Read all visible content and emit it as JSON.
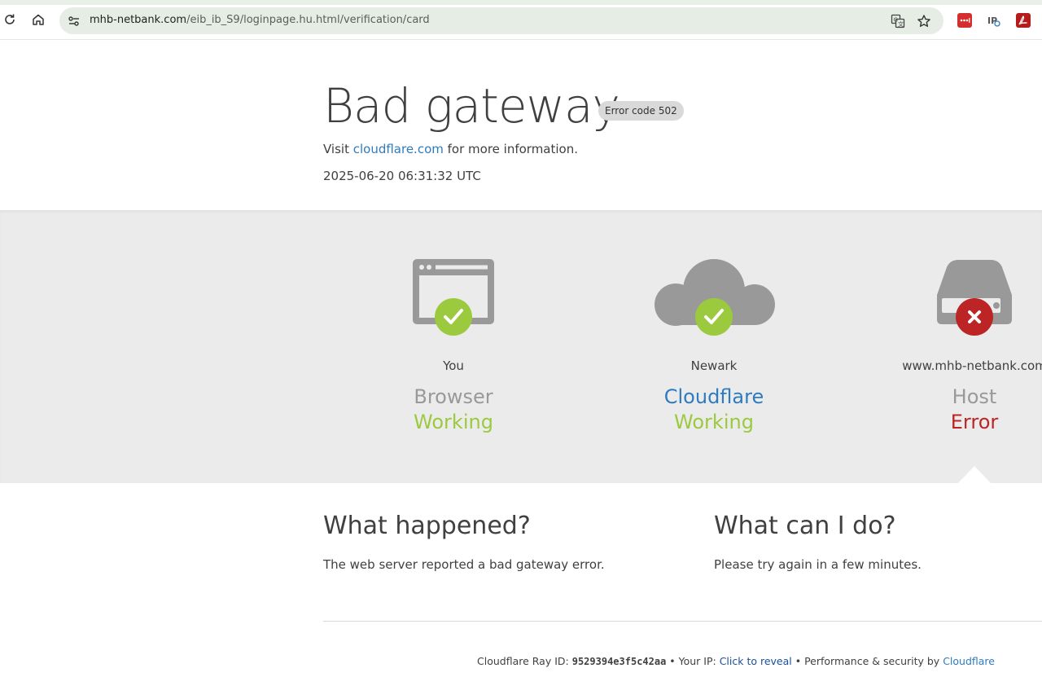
{
  "browser": {
    "url_host": "mhb-netbank.com",
    "url_path": "/eib_ib_S9/loginpage.hu.html/verification/card",
    "icons": [
      "reload-icon",
      "home-icon",
      "site-settings-icon",
      "translate-icon",
      "bookmark-star-icon",
      "extension-lastpass-icon",
      "extension-ip-icon",
      "extension-pdf-icon"
    ]
  },
  "header": {
    "title": "Bad gateway",
    "badge": "Error code 502",
    "visit_prefix": "Visit ",
    "visit_link": "cloudflare.com",
    "visit_suffix": " for more information.",
    "timestamp": "2025-06-20 06:31:32 UTC"
  },
  "nodes": [
    {
      "location": "You",
      "name": "Browser",
      "status": "Working",
      "state": "ok",
      "icon": "browser-icon"
    },
    {
      "location": "Newark",
      "name": "Cloudflare",
      "status": "Working",
      "state": "ok",
      "icon": "cloud-icon"
    },
    {
      "location": "www.mhb-netbank.com",
      "name": "Host",
      "status": "Error",
      "state": "error",
      "icon": "server-icon"
    }
  ],
  "what_happened": {
    "heading": "What happened?",
    "text": "The web server reported a bad gateway error."
  },
  "what_can_i_do": {
    "heading": "What can I do?",
    "text": "Please try again in a few minutes."
  },
  "footer": {
    "ray_label": "Cloudflare Ray ID: ",
    "ray_id": "9529394e3f5c42aa",
    "sep1": " • Your IP: ",
    "reveal": "Click to reveal",
    "sep2": " • Performance & security by ",
    "cf_link": "Cloudflare"
  },
  "colors": {
    "ok": "#9bca3e",
    "error": "#bd2426",
    "link": "#2f7bbf",
    "band": "#ebebeb",
    "icon_gray": "#999999"
  }
}
